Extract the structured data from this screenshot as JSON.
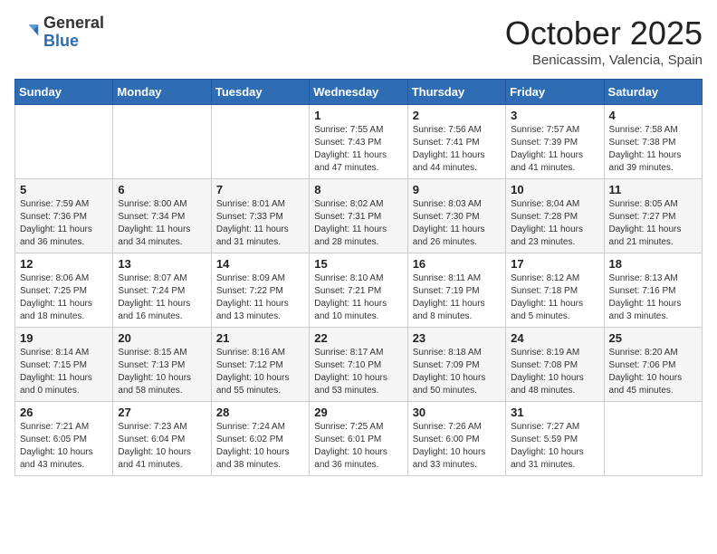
{
  "header": {
    "logo_general": "General",
    "logo_blue": "Blue",
    "month_title": "October 2025",
    "subtitle": "Benicassim, Valencia, Spain"
  },
  "days_of_week": [
    "Sunday",
    "Monday",
    "Tuesday",
    "Wednesday",
    "Thursday",
    "Friday",
    "Saturday"
  ],
  "weeks": [
    [
      {
        "day": "",
        "info": ""
      },
      {
        "day": "",
        "info": ""
      },
      {
        "day": "",
        "info": ""
      },
      {
        "day": "1",
        "info": "Sunrise: 7:55 AM\nSunset: 7:43 PM\nDaylight: 11 hours\nand 47 minutes."
      },
      {
        "day": "2",
        "info": "Sunrise: 7:56 AM\nSunset: 7:41 PM\nDaylight: 11 hours\nand 44 minutes."
      },
      {
        "day": "3",
        "info": "Sunrise: 7:57 AM\nSunset: 7:39 PM\nDaylight: 11 hours\nand 41 minutes."
      },
      {
        "day": "4",
        "info": "Sunrise: 7:58 AM\nSunset: 7:38 PM\nDaylight: 11 hours\nand 39 minutes."
      }
    ],
    [
      {
        "day": "5",
        "info": "Sunrise: 7:59 AM\nSunset: 7:36 PM\nDaylight: 11 hours\nand 36 minutes."
      },
      {
        "day": "6",
        "info": "Sunrise: 8:00 AM\nSunset: 7:34 PM\nDaylight: 11 hours\nand 34 minutes."
      },
      {
        "day": "7",
        "info": "Sunrise: 8:01 AM\nSunset: 7:33 PM\nDaylight: 11 hours\nand 31 minutes."
      },
      {
        "day": "8",
        "info": "Sunrise: 8:02 AM\nSunset: 7:31 PM\nDaylight: 11 hours\nand 28 minutes."
      },
      {
        "day": "9",
        "info": "Sunrise: 8:03 AM\nSunset: 7:30 PM\nDaylight: 11 hours\nand 26 minutes."
      },
      {
        "day": "10",
        "info": "Sunrise: 8:04 AM\nSunset: 7:28 PM\nDaylight: 11 hours\nand 23 minutes."
      },
      {
        "day": "11",
        "info": "Sunrise: 8:05 AM\nSunset: 7:27 PM\nDaylight: 11 hours\nand 21 minutes."
      }
    ],
    [
      {
        "day": "12",
        "info": "Sunrise: 8:06 AM\nSunset: 7:25 PM\nDaylight: 11 hours\nand 18 minutes."
      },
      {
        "day": "13",
        "info": "Sunrise: 8:07 AM\nSunset: 7:24 PM\nDaylight: 11 hours\nand 16 minutes."
      },
      {
        "day": "14",
        "info": "Sunrise: 8:09 AM\nSunset: 7:22 PM\nDaylight: 11 hours\nand 13 minutes."
      },
      {
        "day": "15",
        "info": "Sunrise: 8:10 AM\nSunset: 7:21 PM\nDaylight: 11 hours\nand 10 minutes."
      },
      {
        "day": "16",
        "info": "Sunrise: 8:11 AM\nSunset: 7:19 PM\nDaylight: 11 hours\nand 8 minutes."
      },
      {
        "day": "17",
        "info": "Sunrise: 8:12 AM\nSunset: 7:18 PM\nDaylight: 11 hours\nand 5 minutes."
      },
      {
        "day": "18",
        "info": "Sunrise: 8:13 AM\nSunset: 7:16 PM\nDaylight: 11 hours\nand 3 minutes."
      }
    ],
    [
      {
        "day": "19",
        "info": "Sunrise: 8:14 AM\nSunset: 7:15 PM\nDaylight: 11 hours\nand 0 minutes."
      },
      {
        "day": "20",
        "info": "Sunrise: 8:15 AM\nSunset: 7:13 PM\nDaylight: 10 hours\nand 58 minutes."
      },
      {
        "day": "21",
        "info": "Sunrise: 8:16 AM\nSunset: 7:12 PM\nDaylight: 10 hours\nand 55 minutes."
      },
      {
        "day": "22",
        "info": "Sunrise: 8:17 AM\nSunset: 7:10 PM\nDaylight: 10 hours\nand 53 minutes."
      },
      {
        "day": "23",
        "info": "Sunrise: 8:18 AM\nSunset: 7:09 PM\nDaylight: 10 hours\nand 50 minutes."
      },
      {
        "day": "24",
        "info": "Sunrise: 8:19 AM\nSunset: 7:08 PM\nDaylight: 10 hours\nand 48 minutes."
      },
      {
        "day": "25",
        "info": "Sunrise: 8:20 AM\nSunset: 7:06 PM\nDaylight: 10 hours\nand 45 minutes."
      }
    ],
    [
      {
        "day": "26",
        "info": "Sunrise: 7:21 AM\nSunset: 6:05 PM\nDaylight: 10 hours\nand 43 minutes."
      },
      {
        "day": "27",
        "info": "Sunrise: 7:23 AM\nSunset: 6:04 PM\nDaylight: 10 hours\nand 41 minutes."
      },
      {
        "day": "28",
        "info": "Sunrise: 7:24 AM\nSunset: 6:02 PM\nDaylight: 10 hours\nand 38 minutes."
      },
      {
        "day": "29",
        "info": "Sunrise: 7:25 AM\nSunset: 6:01 PM\nDaylight: 10 hours\nand 36 minutes."
      },
      {
        "day": "30",
        "info": "Sunrise: 7:26 AM\nSunset: 6:00 PM\nDaylight: 10 hours\nand 33 minutes."
      },
      {
        "day": "31",
        "info": "Sunrise: 7:27 AM\nSunset: 5:59 PM\nDaylight: 10 hours\nand 31 minutes."
      },
      {
        "day": "",
        "info": ""
      }
    ]
  ]
}
